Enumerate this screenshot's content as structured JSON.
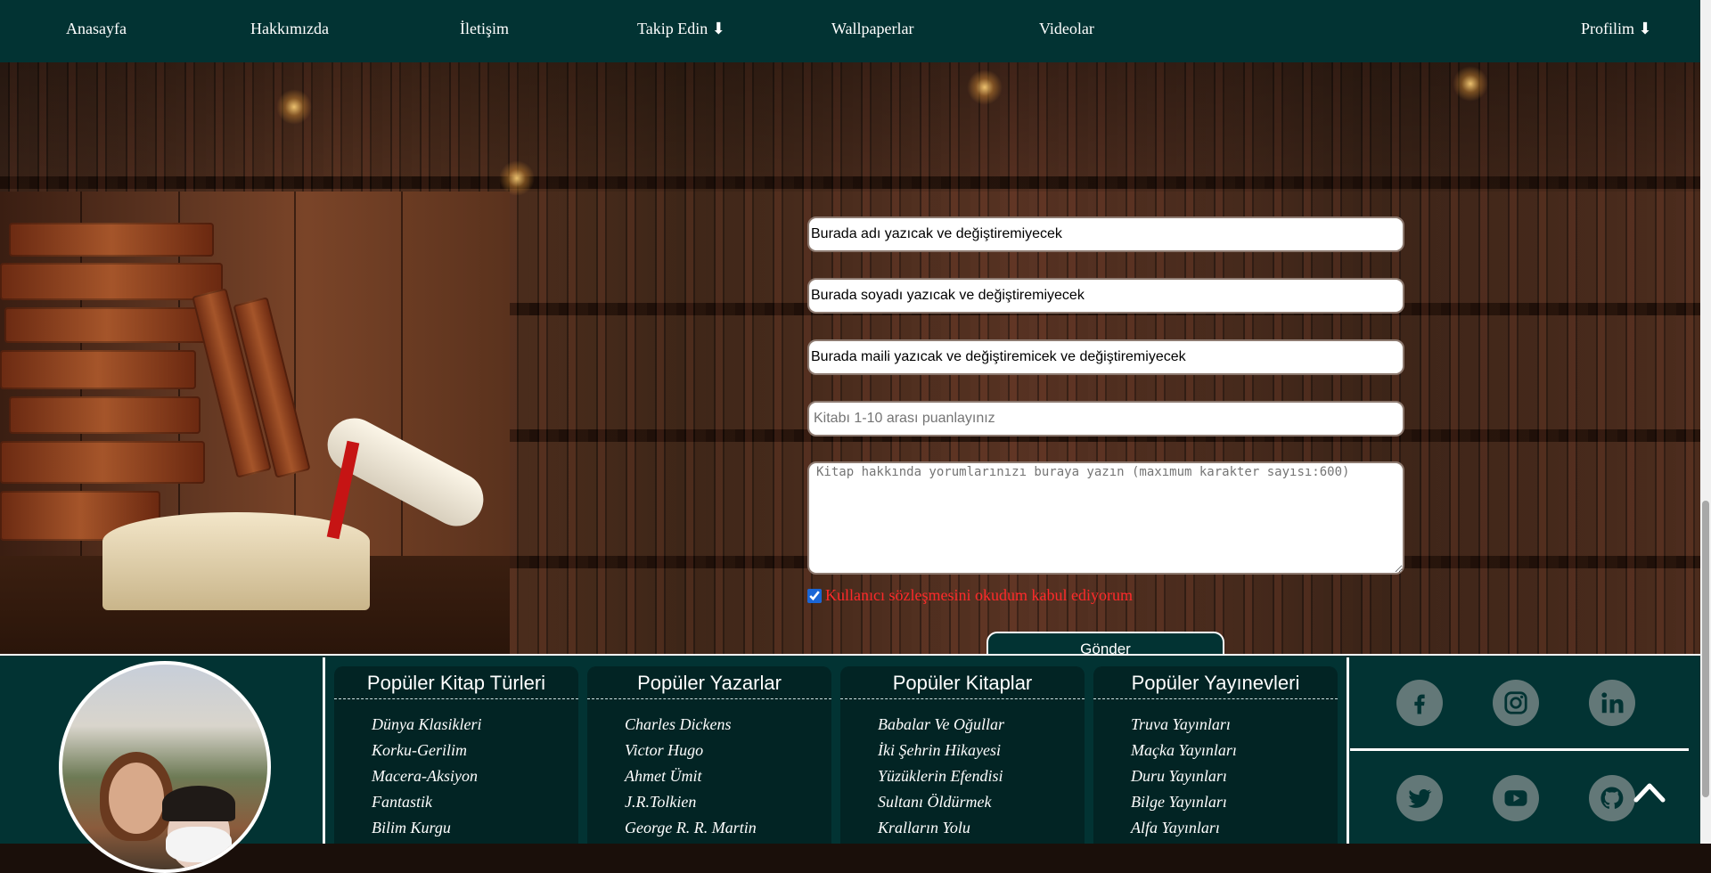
{
  "nav": {
    "home": "Anasayfa",
    "about": "Hakkımızda",
    "contact": "İletişim",
    "follow": "Takip Edin ⬇",
    "wallpapers": "Wallpaperlar",
    "videos": "Videolar",
    "profile": "Profilim ⬇"
  },
  "form": {
    "name_value": "Burada adı yazıcak ve değiştiremiyecek",
    "surname_value": "Burada soyadı yazıcak ve değiştiremiyecek",
    "email_value": "Burada maili yazıcak ve değiştiremicek ve değiştiremiyecek",
    "rating_placeholder": "Kitabı 1-10 arası puanlayınız",
    "comment_placeholder": "Kitap hakkında yorumlarınızı buraya yazın (maxımum karakter sayısı:600)",
    "agree_label": "Kullanıcı sözleşmesini okudum kabul ediyorum",
    "agree_checked": true,
    "submit_label": "Gönder"
  },
  "footer": {
    "columns": [
      {
        "title": "Popüler Kitap Türleri",
        "items": [
          "Dünya Klasikleri",
          "Korku-Gerilim",
          "Macera-Aksiyon",
          "Fantastik",
          "Bilim Kurgu"
        ]
      },
      {
        "title": "Popüler Yazarlar",
        "items": [
          "Charles Dickens",
          "Victor Hugo",
          "Ahmet Ümit",
          "J.R.Tolkien",
          "George R. R. Martin"
        ]
      },
      {
        "title": "Popüler Kitaplar",
        "items": [
          "Babalar Ve Oğullar",
          "İki Şehrin Hikayesi",
          "Yüzüklerin Efendisi",
          "Sultanı Öldürmek",
          "Kralların Yolu"
        ]
      },
      {
        "title": "Popüler Yayınevleri",
        "items": [
          "Truva Yayınları",
          "Maçka Yayınları",
          "Duru Yayınları",
          "Bilge Yayınları",
          "Alfa Yayınları"
        ]
      }
    ],
    "social_icons": [
      "facebook-icon",
      "instagram-icon",
      "linkedin-icon",
      "twitter-icon",
      "youtube-icon",
      "github-icon"
    ]
  },
  "colors": {
    "nav_bg": "#023333",
    "footer_bg": "#023333",
    "column_bg": "#022424",
    "agree_text": "#ff2a2a",
    "social_icon_bg": "#637878"
  }
}
